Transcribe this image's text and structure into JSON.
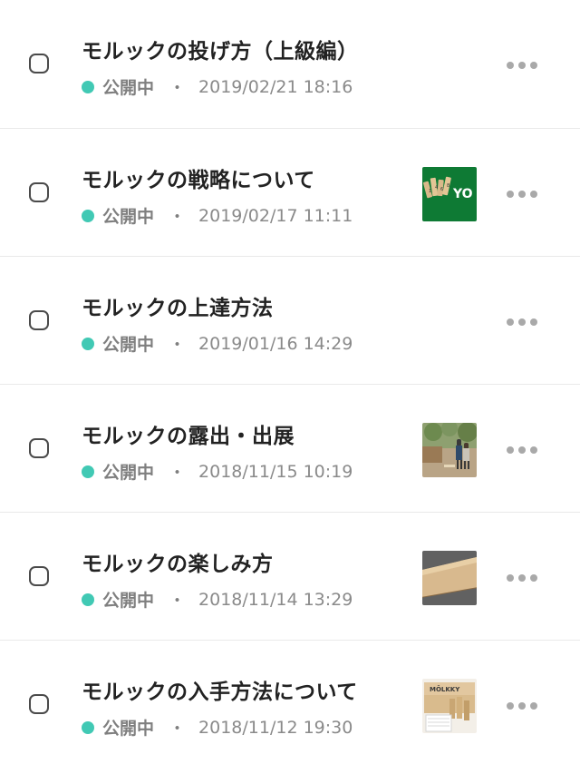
{
  "articles": [
    {
      "title": "モルックの投げ方（上級編）",
      "status": "公開中",
      "separator": "・",
      "date": "2019/02/21 18:16",
      "thumbnail": null
    },
    {
      "title": "モルックの戦略について",
      "status": "公開中",
      "separator": "・",
      "date": "2019/02/17 11:11",
      "thumbnail": "green-logo",
      "thumbnail_text": "YO"
    },
    {
      "title": "モルックの上達方法",
      "status": "公開中",
      "separator": "・",
      "date": "2019/01/16 14:29",
      "thumbnail": null
    },
    {
      "title": "モルックの露出・出展",
      "status": "公開中",
      "separator": "・",
      "date": "2018/11/15 10:19",
      "thumbnail": "outdoor-photo"
    },
    {
      "title": "モルックの楽しみ方",
      "status": "公開中",
      "separator": "・",
      "date": "2018/11/14 13:29",
      "thumbnail": "wooden-stick-photo"
    },
    {
      "title": "モルックの入手方法について",
      "status": "公開中",
      "separator": "・",
      "date": "2018/11/12 19:30",
      "thumbnail": "box-photo",
      "thumbnail_text": "MÖLKKY"
    }
  ],
  "colors": {
    "status_dot": "#41c9b4",
    "title": "#222222",
    "meta": "#7f7f7f",
    "more_dots": "#a9a9a9",
    "divider": "#e9e9e9"
  },
  "icons": {
    "checkbox": "checkbox-icon",
    "status": "status-dot-icon",
    "more": "more-horizontal-icon"
  }
}
